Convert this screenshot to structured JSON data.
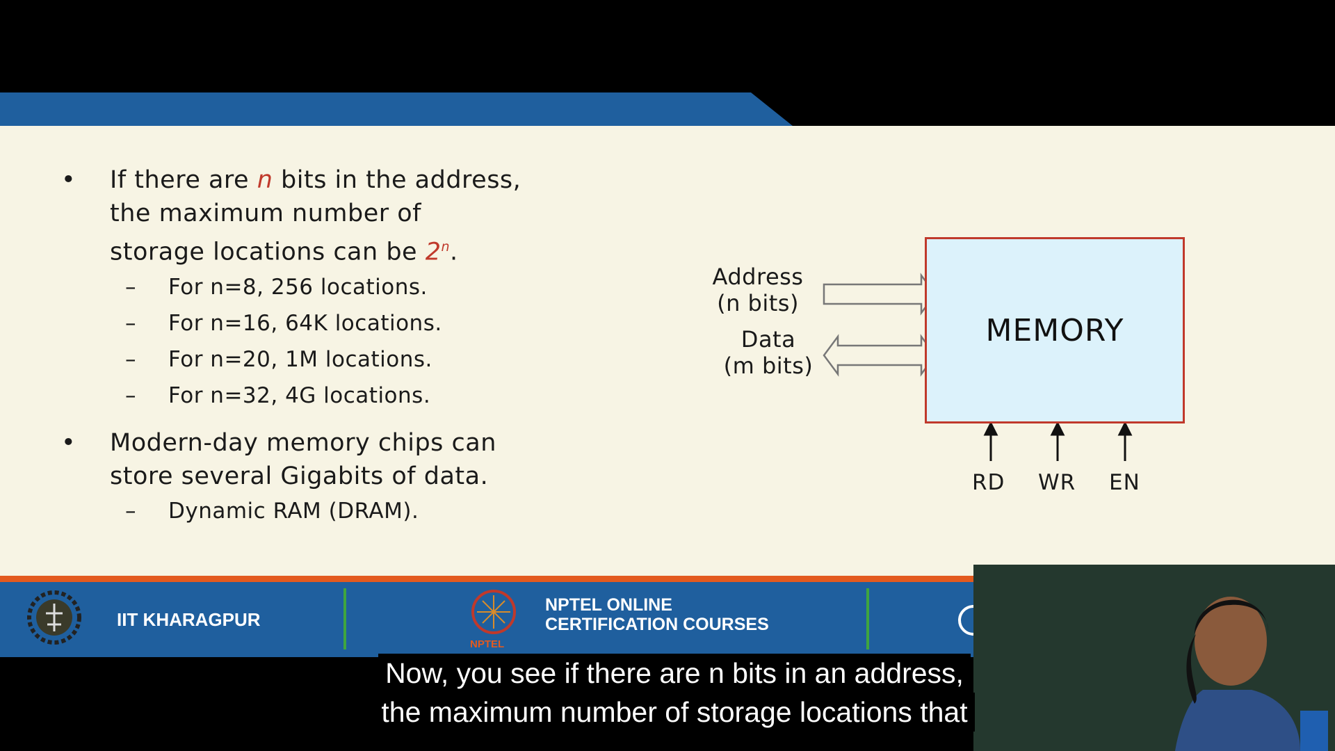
{
  "slide": {
    "bullets": [
      {
        "parts": [
          "If there are ",
          "n",
          " bits in the address,",
          "the maximum number of",
          "storage locations can be ",
          "2",
          "n",
          "."
        ],
        "subitems": [
          "For n=8, 256 locations.",
          "For n=16, 64K locations.",
          "For n=20, 1M locations.",
          "For n=32, 4G locations."
        ]
      },
      {
        "lines": [
          "Modern-day memory chips can",
          "store several Gigabits of data."
        ],
        "subitems": [
          "Dynamic RAM (DRAM)."
        ]
      }
    ],
    "diagram": {
      "box_label": "MEMORY",
      "address_label": "Address",
      "address_bits": "(n bits)",
      "data_label": "Data",
      "data_bits": "(m bits)",
      "controls": [
        "RD",
        "WR",
        "EN"
      ],
      "box_color": "#dcf2fb",
      "border_color": "#c0392b"
    }
  },
  "footer": {
    "institute": "IIT KHARAGPUR",
    "nptel_line1": "NPTEL ONLINE",
    "nptel_line2": "CERTIFICATION COURSES",
    "nptel_logo_text": "NPTEL"
  },
  "subtitles": {
    "line1": "Now, you see if there are n bits in an address,",
    "line2": "the maximum number of storage locations that"
  },
  "colors": {
    "slide_bg": "#f7f4e4",
    "accent_blue": "#1f5f9e",
    "accent_red": "#c0392b",
    "accent_orange": "#e35a1f"
  }
}
